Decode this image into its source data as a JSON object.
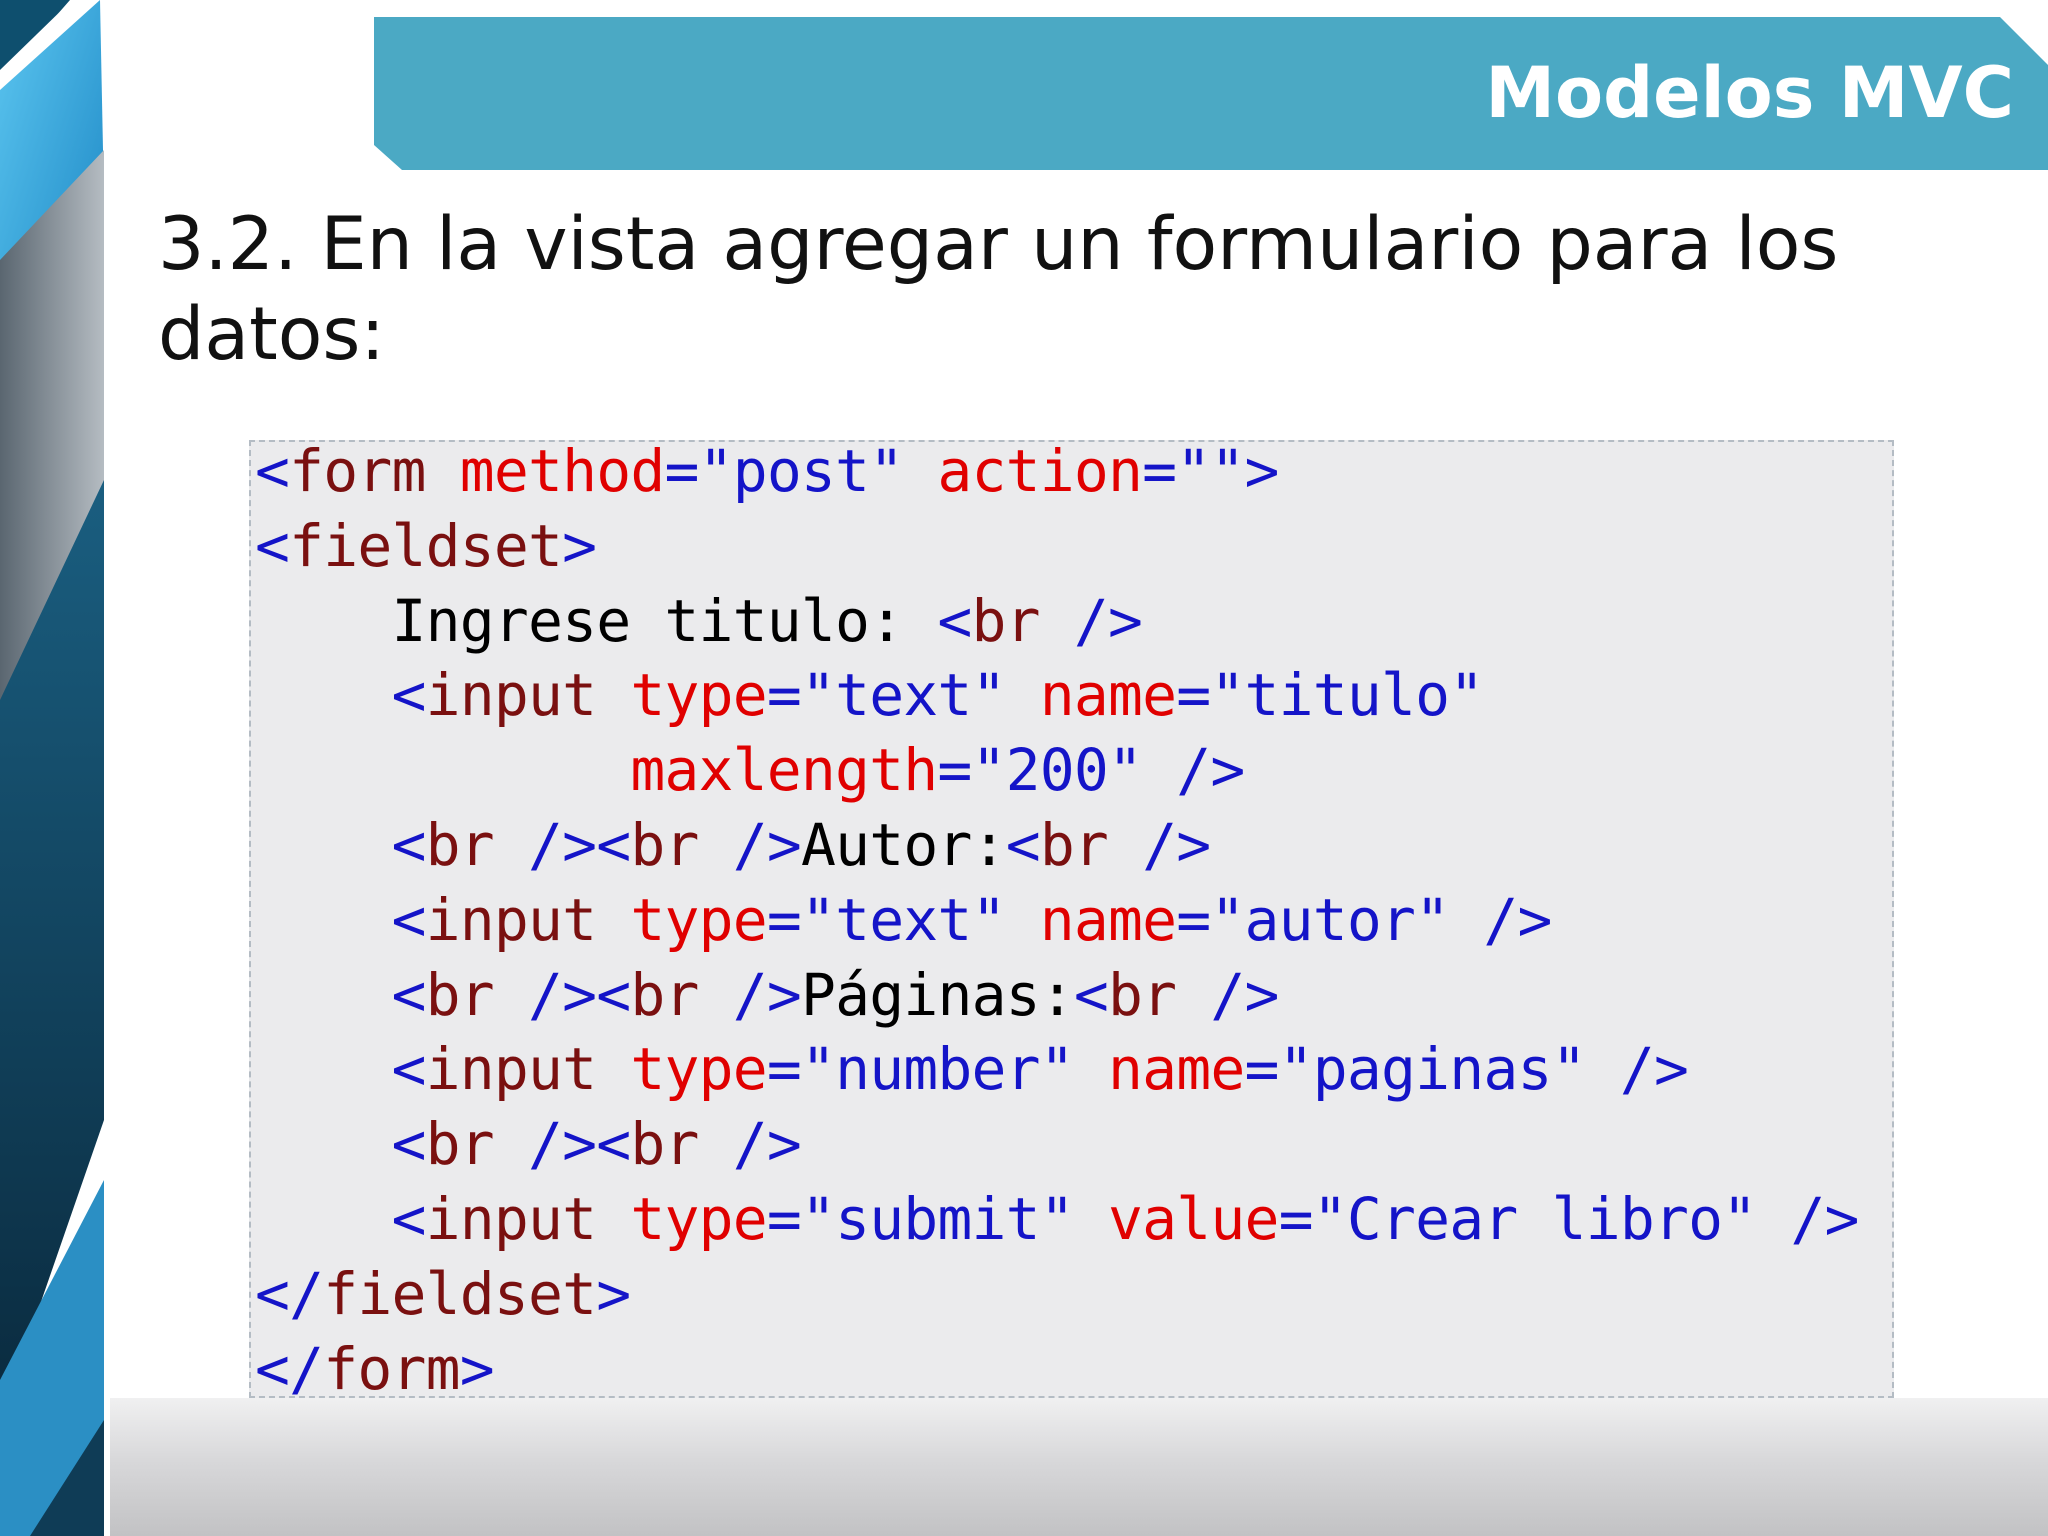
{
  "slide": {
    "header_title": "Modelos MVC",
    "heading": "3.2. En la vista agregar un formulario para los datos:",
    "colors": {
      "header_bar": "#4ba9c4",
      "deco_blue": "#2aa3de",
      "deco_dark": "#0c3a52",
      "code_background": "#ebebed",
      "code_bracket": "#1414c8",
      "code_tag": "#7a1010",
      "code_attribute": "#e00000",
      "code_string": "#1414c8",
      "code_text": "#000000"
    }
  },
  "code_lines": [
    [
      [
        "blue",
        "<"
      ],
      [
        "tag",
        "form"
      ],
      [
        "text",
        " "
      ],
      [
        "attr",
        "method"
      ],
      [
        "blue",
        "="
      ],
      [
        "str",
        "\"post\""
      ],
      [
        "text",
        " "
      ],
      [
        "attr",
        "action"
      ],
      [
        "blue",
        "="
      ],
      [
        "str",
        "\"\""
      ],
      [
        "blue",
        ">"
      ]
    ],
    [
      [
        "blue",
        "<"
      ],
      [
        "tag",
        "fieldset"
      ],
      [
        "blue",
        ">"
      ]
    ],
    [
      [
        "text",
        "    Ingrese titulo: "
      ],
      [
        "blue",
        "<"
      ],
      [
        "tag",
        "br"
      ],
      [
        "text",
        " "
      ],
      [
        "blue",
        "/>"
      ]
    ],
    [
      [
        "text",
        "    "
      ],
      [
        "blue",
        "<"
      ],
      [
        "tag",
        "input"
      ],
      [
        "text",
        " "
      ],
      [
        "attr",
        "type"
      ],
      [
        "blue",
        "="
      ],
      [
        "str",
        "\"text\""
      ],
      [
        "text",
        " "
      ],
      [
        "attr",
        "name"
      ],
      [
        "blue",
        "="
      ],
      [
        "str",
        "\"titulo\""
      ]
    ],
    [
      [
        "text",
        "           "
      ],
      [
        "attr",
        "maxlength"
      ],
      [
        "blue",
        "="
      ],
      [
        "str",
        "\"200\""
      ],
      [
        "text",
        " "
      ],
      [
        "blue",
        "/>"
      ]
    ],
    [
      [
        "text",
        "    "
      ],
      [
        "blue",
        "<"
      ],
      [
        "tag",
        "br"
      ],
      [
        "text",
        " "
      ],
      [
        "blue",
        "/><"
      ],
      [
        "tag",
        "br"
      ],
      [
        "text",
        " "
      ],
      [
        "blue",
        "/>"
      ],
      [
        "text",
        "Autor:"
      ],
      [
        "blue",
        "<"
      ],
      [
        "tag",
        "br"
      ],
      [
        "text",
        " "
      ],
      [
        "blue",
        "/>"
      ]
    ],
    [
      [
        "text",
        "    "
      ],
      [
        "blue",
        "<"
      ],
      [
        "tag",
        "input"
      ],
      [
        "text",
        " "
      ],
      [
        "attr",
        "type"
      ],
      [
        "blue",
        "="
      ],
      [
        "str",
        "\"text\""
      ],
      [
        "text",
        " "
      ],
      [
        "attr",
        "name"
      ],
      [
        "blue",
        "="
      ],
      [
        "str",
        "\"autor\""
      ],
      [
        "text",
        " "
      ],
      [
        "blue",
        "/>"
      ]
    ],
    [
      [
        "text",
        "    "
      ],
      [
        "blue",
        "<"
      ],
      [
        "tag",
        "br"
      ],
      [
        "text",
        " "
      ],
      [
        "blue",
        "/><"
      ],
      [
        "tag",
        "br"
      ],
      [
        "text",
        " "
      ],
      [
        "blue",
        "/>"
      ],
      [
        "text",
        "Páginas:"
      ],
      [
        "blue",
        "<"
      ],
      [
        "tag",
        "br"
      ],
      [
        "text",
        " "
      ],
      [
        "blue",
        "/>"
      ]
    ],
    [
      [
        "text",
        "    "
      ],
      [
        "blue",
        "<"
      ],
      [
        "tag",
        "input"
      ],
      [
        "text",
        " "
      ],
      [
        "attr",
        "type"
      ],
      [
        "blue",
        "="
      ],
      [
        "str",
        "\"number\""
      ],
      [
        "text",
        " "
      ],
      [
        "attr",
        "name"
      ],
      [
        "blue",
        "="
      ],
      [
        "str",
        "\"paginas\""
      ],
      [
        "text",
        " "
      ],
      [
        "blue",
        "/>"
      ]
    ],
    [
      [
        "text",
        "    "
      ],
      [
        "blue",
        "<"
      ],
      [
        "tag",
        "br"
      ],
      [
        "text",
        " "
      ],
      [
        "blue",
        "/><"
      ],
      [
        "tag",
        "br"
      ],
      [
        "text",
        " "
      ],
      [
        "blue",
        "/>"
      ]
    ],
    [
      [
        "text",
        "    "
      ],
      [
        "blue",
        "<"
      ],
      [
        "tag",
        "input"
      ],
      [
        "text",
        " "
      ],
      [
        "attr",
        "type"
      ],
      [
        "blue",
        "="
      ],
      [
        "str",
        "\"submit\""
      ],
      [
        "text",
        " "
      ],
      [
        "attr",
        "value"
      ],
      [
        "blue",
        "="
      ],
      [
        "str",
        "\"Crear libro\""
      ],
      [
        "text",
        " "
      ],
      [
        "blue",
        "/>"
      ]
    ],
    [
      [
        "blue",
        "</"
      ],
      [
        "tag",
        "fieldset"
      ],
      [
        "blue",
        ">"
      ]
    ],
    [
      [
        "blue",
        "</"
      ],
      [
        "tag",
        "form"
      ],
      [
        "blue",
        ">"
      ]
    ]
  ]
}
